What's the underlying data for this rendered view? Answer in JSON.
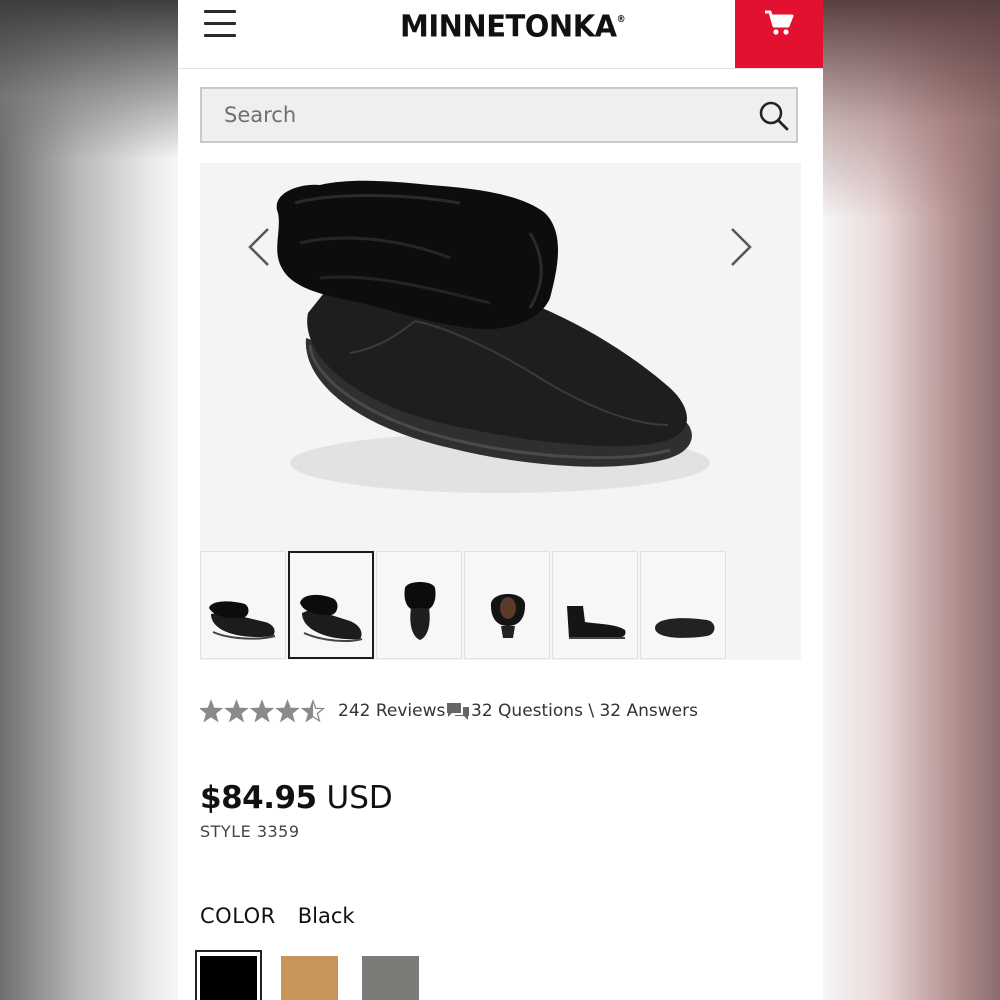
{
  "header": {
    "brand": "MINNETONKA",
    "brand_mark": "®",
    "menu_icon": "hamburger-menu-icon",
    "cart_icon": "shopping-cart-icon",
    "cart_color": "#e3112f"
  },
  "search": {
    "placeholder": "Search",
    "icon": "search-icon"
  },
  "gallery": {
    "prev_icon": "chevron-left-icon",
    "next_icon": "chevron-right-icon",
    "selected_index": 1,
    "thumbnails": [
      "side view",
      "angled view",
      "front view",
      "top view",
      "cuff up view",
      "sole view"
    ]
  },
  "rating": {
    "stars": 4.5,
    "max": 5,
    "reviews_text": "242 Reviews",
    "qa_text": "32 Questions \\ 32 Answers"
  },
  "product": {
    "price": "$84.95",
    "currency": "USD",
    "style": "STYLE 3359"
  },
  "color": {
    "label": "COLOR",
    "selected": "Black",
    "swatches": [
      "#000000",
      "#c7955a",
      "#7b7b78"
    ]
  }
}
